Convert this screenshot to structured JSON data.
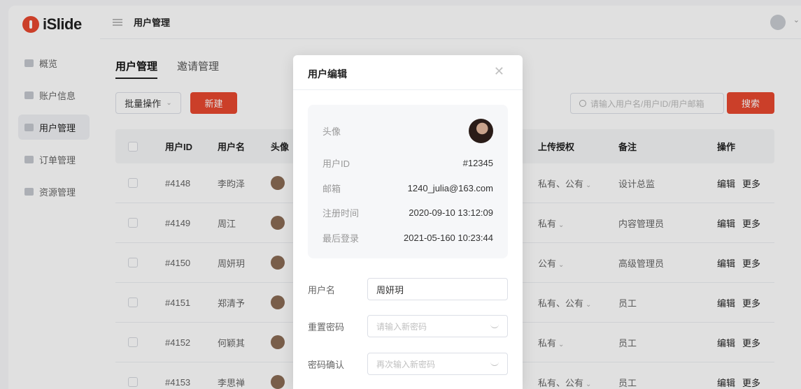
{
  "brand": {
    "name": "iSlide",
    "accent": "#e8482f"
  },
  "sidebar": {
    "items": [
      {
        "label": "概览",
        "icon": "dashboard-icon"
      },
      {
        "label": "账户信息",
        "icon": "account-icon"
      },
      {
        "label": "用户管理",
        "icon": "user-icon"
      },
      {
        "label": "订单管理",
        "icon": "order-icon"
      },
      {
        "label": "资源管理",
        "icon": "resource-icon"
      }
    ]
  },
  "header": {
    "title": "用户管理"
  },
  "main": {
    "tabs": [
      {
        "label": "用户管理"
      },
      {
        "label": "邀请管理"
      }
    ],
    "batch_label": "批量操作",
    "new_label": "新建",
    "search_placeholder": "请输入用户名/用户ID/用户邮箱",
    "search_label": "搜索"
  },
  "table": {
    "headers": {
      "id": "用户ID",
      "name": "用户名",
      "avatar": "头像",
      "upload": "上传授权",
      "note": "备注",
      "ops": "操作"
    },
    "rows": [
      {
        "id": "#4148",
        "name": "李昀泽",
        "upload": "私有、公有",
        "note": "设计总监"
      },
      {
        "id": "#4149",
        "name": "周江",
        "upload": "私有",
        "note": "内容管理员"
      },
      {
        "id": "#4150",
        "name": "周妍玥",
        "upload": "公有",
        "note": "高级管理员"
      },
      {
        "id": "#4151",
        "name": "郑清予",
        "upload": "私有、公有",
        "note": "员工"
      },
      {
        "id": "#4152",
        "name": "何颖其",
        "upload": "私有",
        "note": "员工"
      },
      {
        "id": "#4153",
        "name": "李思禅",
        "upload": "私有、公有",
        "note": "员工"
      }
    ],
    "op_edit": "编辑",
    "op_more": "更多"
  },
  "modal": {
    "title": "用户编辑",
    "info": {
      "avatar_label": "头像",
      "id_label": "用户ID",
      "id_value": "#12345",
      "email_label": "邮箱",
      "email_value": "1240_julia@163.com",
      "reg_label": "注册时间",
      "reg_value": "2020-09-10 13:12:09",
      "login_label": "最后登录",
      "login_value": "2021-05-160 10:23:44"
    },
    "form": {
      "name_label": "用户名",
      "name_value": "周妍玥",
      "pwd_label": "重置密码",
      "pwd_placeholder": "请输入新密码",
      "confirm_label": "密码确认",
      "confirm_placeholder": "再次输入新密码"
    }
  }
}
